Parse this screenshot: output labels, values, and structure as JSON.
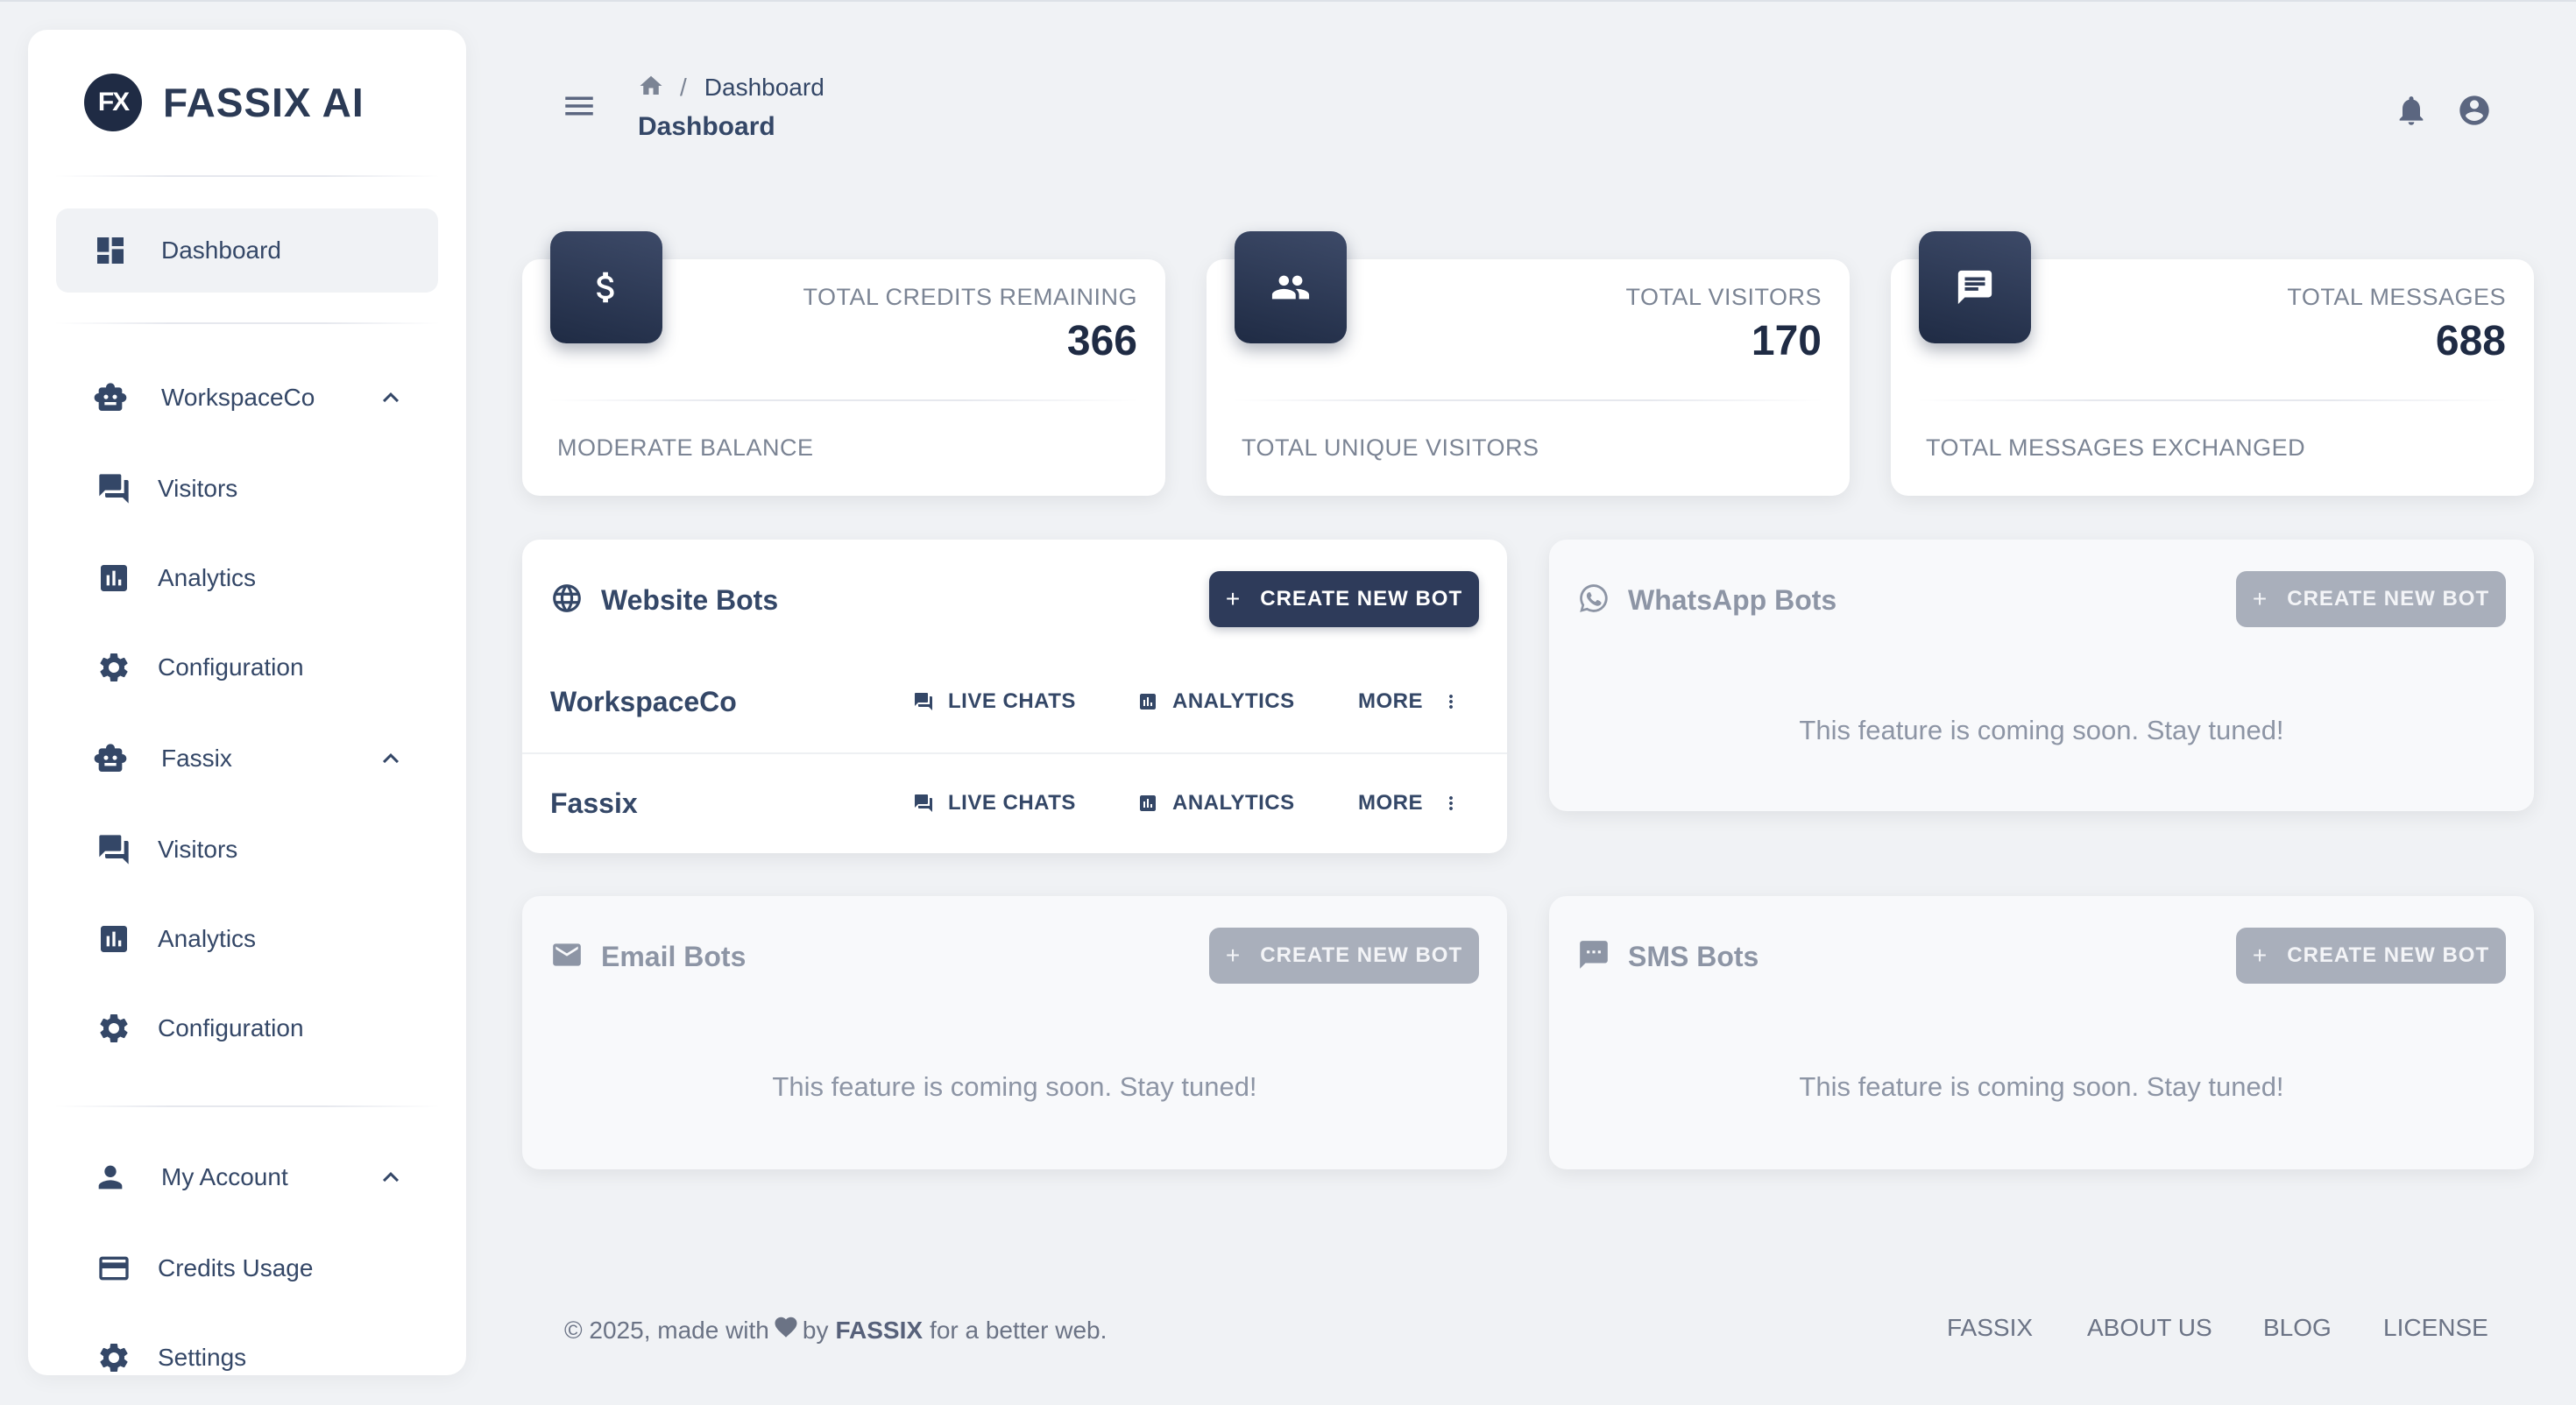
{
  "brand": {
    "logo_text": "FX",
    "name": "FASSIX AI"
  },
  "sidebar": {
    "dashboard": "Dashboard",
    "workspace1": {
      "name": "WorkspaceCo",
      "items": [
        "Visitors",
        "Analytics",
        "Configuration"
      ]
    },
    "workspace2": {
      "name": "Fassix",
      "items": [
        "Visitors",
        "Analytics",
        "Configuration"
      ]
    },
    "account": {
      "name": "My Account",
      "items": [
        "Credits Usage",
        "Settings"
      ]
    }
  },
  "header": {
    "breadcrumb_separator": "/",
    "breadcrumb_current": "Dashboard",
    "page_title": "Dashboard"
  },
  "stats": [
    {
      "label": "TOTAL CREDITS REMAINING",
      "value": "366",
      "footer": "MODERATE BALANCE"
    },
    {
      "label": "TOTAL VISITORS",
      "value": "170",
      "footer": "TOTAL UNIQUE VISITORS"
    },
    {
      "label": "TOTAL MESSAGES",
      "value": "688",
      "footer": "TOTAL MESSAGES EXCHANGED"
    }
  ],
  "create_button": {
    "plus": "+",
    "label": "CREATE NEW BOT"
  },
  "website_bots": {
    "title": "Website Bots",
    "rows": [
      {
        "name": "WorkspaceCo",
        "live_chats": "LIVE CHATS",
        "analytics": "ANALYTICS",
        "more": "MORE"
      },
      {
        "name": "Fassix",
        "live_chats": "LIVE CHATS",
        "analytics": "ANALYTICS",
        "more": "MORE"
      }
    ]
  },
  "whatsapp_bots": {
    "title": "WhatsApp Bots",
    "message": "This feature is coming soon. Stay tuned!"
  },
  "email_bots": {
    "title": "Email Bots",
    "message": "This feature is coming soon. Stay tuned!"
  },
  "sms_bots": {
    "title": "SMS Bots",
    "message": "This feature is coming soon. Stay tuned!"
  },
  "footer": {
    "prefix": "© 2025, made with",
    "by": "by",
    "brand": "FASSIX",
    "suffix": "for a better web.",
    "links": [
      "FASSIX",
      "ABOUT US",
      "BLOG",
      "LICENSE"
    ]
  },
  "colors": {
    "primary": "#2e3b5a",
    "disabled_button": "#a9afbb",
    "background": "#f0f2f5",
    "text": "#344767"
  },
  "icons": [
    "dashboard-icon",
    "robot-icon",
    "forum-icon",
    "chart-icon",
    "gear-icon",
    "person-icon",
    "credit-card-icon",
    "dollar-icon",
    "people-icon",
    "message-icon",
    "globe-icon",
    "whatsapp-icon",
    "mail-icon",
    "sms-icon",
    "bell-icon",
    "account-circle-icon",
    "home-icon",
    "menu-icon"
  ]
}
